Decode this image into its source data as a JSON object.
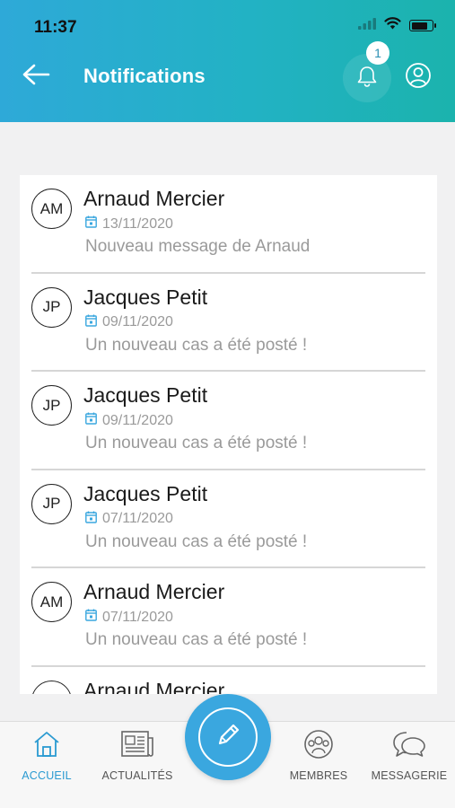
{
  "status_bar": {
    "time": "11:37",
    "battery_level": 0.8
  },
  "header": {
    "title": "Notifications",
    "back_icon": "arrow-left-icon",
    "bell_icon": "bell-icon",
    "badge_count": "1",
    "profile_icon": "user-circle-icon",
    "gradient_start": "#2ea9d8",
    "gradient_end": "#1bb3ad"
  },
  "notifications": [
    {
      "initials": "AM",
      "name": "Arnaud Mercier",
      "date": "13/11/2020",
      "message": "Nouveau message de Arnaud"
    },
    {
      "initials": "JP",
      "name": "Jacques Petit",
      "date": "09/11/2020",
      "message": "Un nouveau cas a été posté !"
    },
    {
      "initials": "JP",
      "name": "Jacques Petit",
      "date": "09/11/2020",
      "message": "Un nouveau cas a été posté !"
    },
    {
      "initials": "JP",
      "name": "Jacques Petit",
      "date": "07/11/2020",
      "message": "Un nouveau cas a été posté !"
    },
    {
      "initials": "AM",
      "name": "Arnaud Mercier",
      "date": "07/11/2020",
      "message": "Un nouveau cas a été posté !"
    },
    {
      "initials": "AM",
      "name": "Arnaud Mercier",
      "date": "",
      "message": ""
    }
  ],
  "bottom_nav": {
    "items": [
      {
        "label": "ACCUEIL",
        "icon": "home-icon",
        "active": true
      },
      {
        "label": "ACTUALITÉS",
        "icon": "newspaper-icon",
        "active": false
      },
      {
        "label": "MEMBRES",
        "icon": "members-icon",
        "active": false
      },
      {
        "label": "MESSAGERIE",
        "icon": "chat-icon",
        "active": false
      }
    ],
    "fab_icon": "pencil-icon"
  },
  "colors": {
    "accent": "#3aa7df",
    "active_nav": "#2a9ad1",
    "muted_text": "#9a9a9a"
  }
}
